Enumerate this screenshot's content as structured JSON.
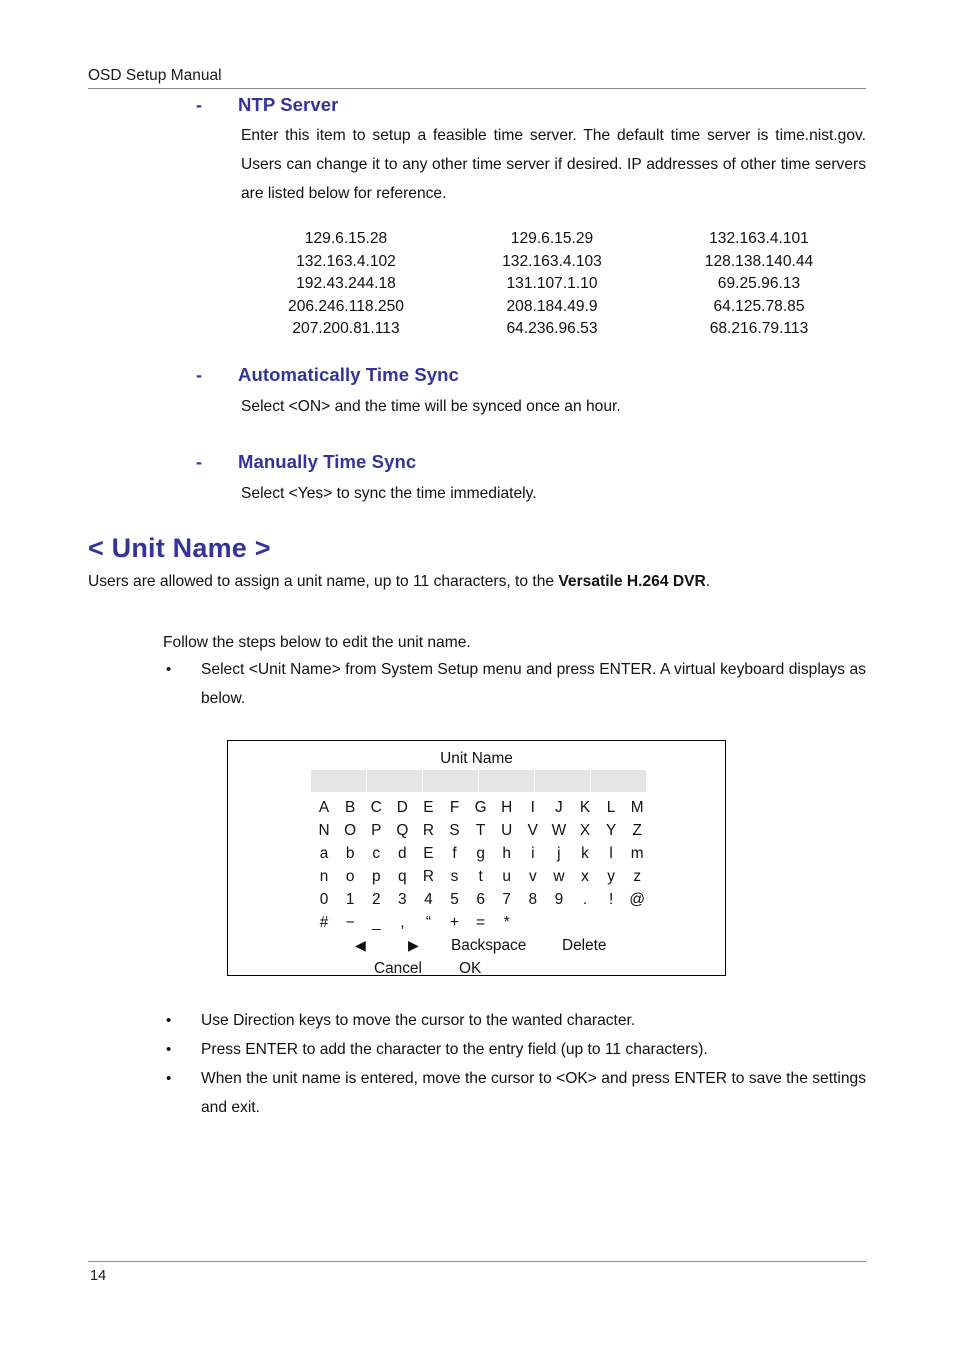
{
  "header": {
    "title": "OSD Setup Manual"
  },
  "footer": {
    "page_number": "14"
  },
  "sections": {
    "ntp_server": {
      "marker": "-",
      "heading": "NTP Server",
      "body": "Enter this item to setup a feasible time server. The default time server is time.nist.gov. Users can change it to any other time server if desired. IP addresses of other time servers are listed below for reference."
    },
    "auto_sync": {
      "marker": "-",
      "heading": "Automatically Time Sync",
      "body": "Select <ON> and the time will be synced once an hour."
    },
    "manual_sync": {
      "marker": "-",
      "heading": "Manually Time Sync",
      "body": "Select <Yes> to sync the time immediately."
    }
  },
  "ip_table": {
    "rows": [
      [
        "129.6.15.28",
        "129.6.15.29",
        "132.163.4.101"
      ],
      [
        "132.163.4.102",
        "132.163.4.103",
        "128.138.140.44"
      ],
      [
        "192.43.244.18",
        "131.107.1.10",
        "69.25.96.13"
      ],
      [
        "206.246.118.250",
        "208.184.49.9",
        "64.125.78.85"
      ],
      [
        "207.200.81.113",
        "64.236.96.53",
        "68.216.79.113"
      ]
    ]
  },
  "unit_name_section": {
    "heading": "< Unit Name >",
    "intro_part1": "Users are allowed to assign a unit name, up to 11 characters, to the ",
    "intro_bold": "Versatile H.264 DVR",
    "intro_part2": ".",
    "follow_line": "Follow the steps below to edit the unit name.",
    "bullets_before": [
      {
        "marker": "•",
        "text": "Select <Unit Name> from System Setup menu and press ENTER. A virtual keyboard displays as below."
      }
    ],
    "bullets_after": [
      {
        "marker": "•",
        "text": "Use Direction keys to move the cursor to the wanted character."
      },
      {
        "marker": "•",
        "text": "Press ENTER to add the character to the entry field (up to 11 characters)."
      },
      {
        "marker": "•",
        "text": "When the unit name is entered, move the cursor to <OK> and press ENTER to save the settings and exit."
      }
    ]
  },
  "virtual_keyboard": {
    "title": "Unit Name",
    "entry_field": {
      "value": "",
      "cell_count": 6,
      "background": "#e4e4e4"
    },
    "key_rows": [
      [
        "A",
        "B",
        "C",
        "D",
        "E",
        "F",
        "G",
        "H",
        "I",
        "J",
        "K",
        "L",
        "M"
      ],
      [
        "N",
        "O",
        "P",
        "Q",
        "R",
        "S",
        "T",
        "U",
        "V",
        "W",
        "X",
        "Y",
        "Z"
      ],
      [
        "a",
        "b",
        "c",
        "d",
        "E",
        "f",
        "g",
        "h",
        "i",
        "j",
        "k",
        "l",
        "m"
      ],
      [
        "n",
        "o",
        "p",
        "q",
        "R",
        "s",
        "t",
        "u",
        "v",
        "w",
        "x",
        "y",
        "z"
      ],
      [
        "0",
        "1",
        "2",
        "3",
        "4",
        "5",
        "6",
        "7",
        "8",
        "9",
        ".",
        "!",
        "@"
      ],
      [
        "#",
        "−",
        "_",
        ",",
        "“",
        "+",
        "=",
        "*",
        "",
        "",
        "",
        "",
        ""
      ]
    ],
    "function_keys": {
      "left_arrow": "◀",
      "right_arrow": "▶",
      "backspace": "Backspace",
      "delete": "Delete"
    },
    "action_keys": {
      "cancel": "Cancel",
      "ok": "OK"
    }
  },
  "colors": {
    "heading_blue": "#333399",
    "text_black": "#111111",
    "rule_gray": "#8a8a8a",
    "entry_gray": "#e4e4e4"
  }
}
